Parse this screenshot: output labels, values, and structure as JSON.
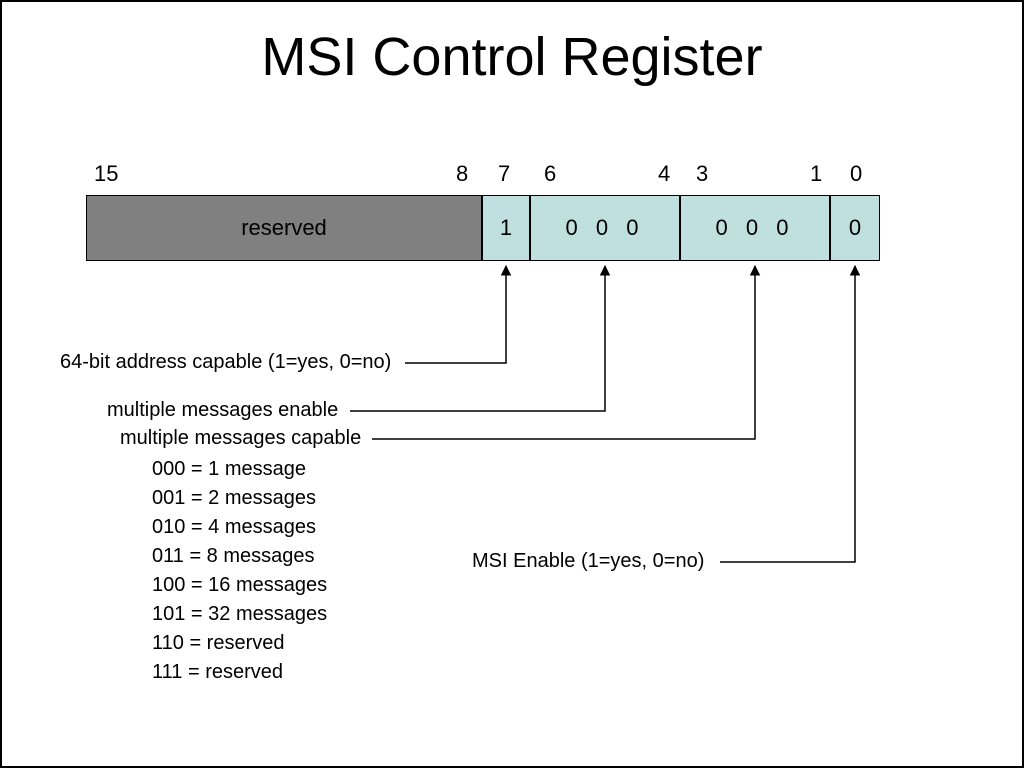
{
  "title": "MSI Control Register",
  "bit_labels": {
    "b15": "15",
    "b8": "8",
    "b7": "7",
    "b6": "6",
    "b4": "4",
    "b3": "3",
    "b1": "1",
    "b0": "0"
  },
  "register": {
    "reserved": "reserved",
    "bit7": "1",
    "bits64": "0 0 0",
    "bits31": "0 0 0",
    "bit0": "0"
  },
  "annotations": {
    "addr64": "64-bit address capable (1=yes, 0=no)",
    "mme": "multiple messages enable",
    "mmc": "multiple messages capable",
    "msi_enable": "MSI Enable (1=yes, 0=no)"
  },
  "codes": {
    "c000": "000 = 1 message",
    "c001": "001 = 2 messages",
    "c010": "010 = 4 messages",
    "c011": "011 = 8 messages",
    "c100": "100 = 16 messages",
    "c101": "101 = 32 messages",
    "c110": "110 = reserved",
    "c111": "111 = reserved"
  }
}
